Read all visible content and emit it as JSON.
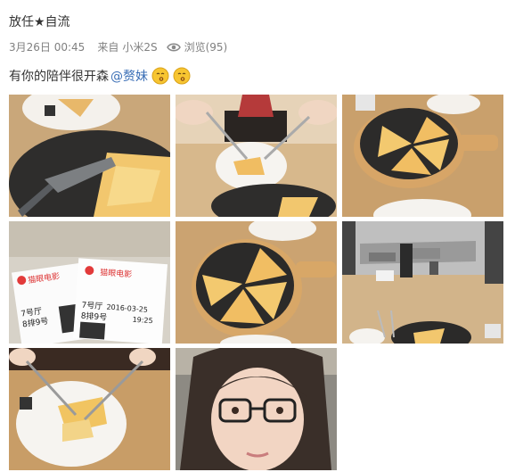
{
  "post": {
    "username": "放任★自流",
    "date": "3月26日 00:45",
    "source_prefix": "来自",
    "device": "小米2S",
    "views_label": "浏览(95)",
    "text": "有你的陪伴很开森",
    "mention": "@赘妹",
    "emoji": [
      "kiss-emoji",
      "kiss-emoji"
    ]
  },
  "photos": [
    {
      "name": "pizza-pan-photo"
    },
    {
      "name": "cutting-pizza-photo"
    },
    {
      "name": "pizza-board-photo"
    },
    {
      "name": "movie-tickets-photo",
      "ticket_brand": "猫眼电影",
      "ticket_date": "2016-03-25",
      "ticket_hall": "7号厅",
      "ticket_seat": "8排9号",
      "ticket_time": "19:25"
    },
    {
      "name": "pizza-top-view-photo"
    },
    {
      "name": "restaurant-window-photo"
    },
    {
      "name": "eating-pizza-photo"
    },
    {
      "name": "selfie-photo"
    }
  ],
  "colors": {
    "link": "#3b6fb6",
    "meta": "#808080",
    "text": "#333333"
  }
}
